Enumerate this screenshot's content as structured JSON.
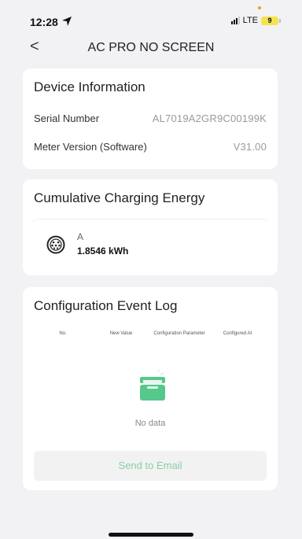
{
  "status_bar": {
    "time": "12:28",
    "location_icon": "location-arrow-icon",
    "network": "LTE",
    "battery": "9",
    "colors": {
      "battery": "#f4e34f",
      "indicator_dot": "#f29b2d"
    }
  },
  "header": {
    "back_label": "<",
    "title": "AC PRO NO SCREEN"
  },
  "device_info": {
    "title": "Device Information",
    "rows": [
      {
        "label": "Serial Number",
        "value": "AL7019A2GR9C00199K"
      },
      {
        "label": "Meter Version (Software)",
        "value": "V31.00"
      }
    ]
  },
  "cumulative": {
    "title": "Cumulative Charging Energy",
    "items": [
      {
        "icon": "type2-plug-icon",
        "channel": "A",
        "energy": "1.8546 kWh"
      }
    ]
  },
  "config_log": {
    "title": "Configuration Event Log",
    "columns": [
      "No.",
      "New Value",
      "Configuration Parameter",
      "Configured At"
    ],
    "empty_icon": "empty-box-icon",
    "empty_text": "No data",
    "button_label": "Send to Email",
    "colors": {
      "accent": "#86d0a5",
      "empty_icon": "#55c88a"
    }
  }
}
